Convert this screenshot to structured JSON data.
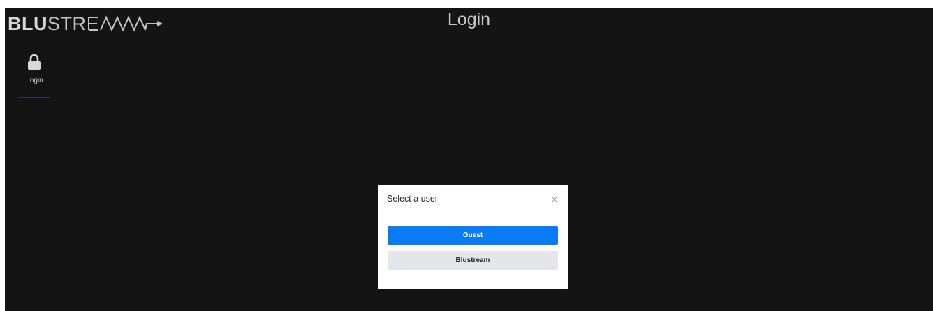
{
  "header": {
    "logo_bold": "BLU",
    "logo_light": "STREAM",
    "page_title": "Login"
  },
  "nav": {
    "items": [
      {
        "label": "Login",
        "icon": "lock-icon"
      }
    ]
  },
  "modal": {
    "title": "Select a user",
    "close_icon": "close-icon",
    "users": [
      {
        "label": "Guest",
        "style": "primary"
      },
      {
        "label": "Blustream",
        "style": "secondary"
      }
    ]
  },
  "colors": {
    "background": "#141414",
    "primary": "#0a7bf5",
    "secondary": "#e4e6e9"
  }
}
